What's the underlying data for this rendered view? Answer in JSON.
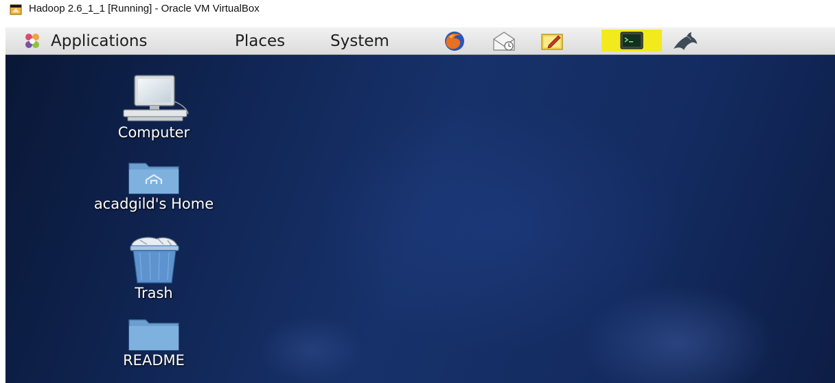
{
  "window": {
    "title": "Hadoop 2.6_1_1 [Running] - Oracle VM VirtualBox"
  },
  "panel": {
    "menus": {
      "applications": "Applications",
      "places": "Places",
      "system": "System"
    },
    "launchers": [
      {
        "icon": "firefox-icon"
      },
      {
        "icon": "mail-icon"
      },
      {
        "icon": "notes-icon"
      },
      {
        "icon": "terminal-icon"
      },
      {
        "icon": "mysql-dolphin-icon"
      }
    ]
  },
  "desktop": {
    "icons": [
      {
        "label": "Computer",
        "icon": "computer-icon"
      },
      {
        "label": "acadgild's Home",
        "icon": "home-folder-icon"
      },
      {
        "label": "Trash",
        "icon": "trash-icon"
      },
      {
        "label": "README",
        "icon": "folder-icon"
      }
    ]
  },
  "colors": {
    "desktop_background": "#132b60",
    "panel_background": "#e6e6e6",
    "terminal_highlight": "#f3ea1e"
  }
}
